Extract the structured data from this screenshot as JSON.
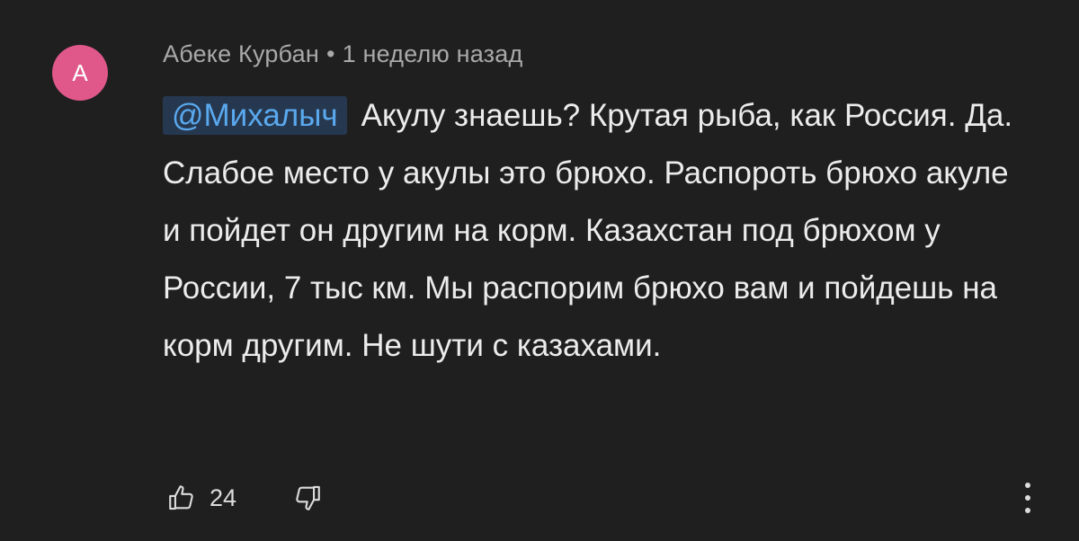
{
  "comment": {
    "avatar_letter": "A",
    "author": "Абеке Курбан",
    "separator": "•",
    "timestamp": "1 неделю назад",
    "mention": "@Михалыч",
    "text": "Акулу знаешь? Крутая рыба, как Россия. Да. Слабое место у акулы это брюхо. Распороть брюхо акуле и пойдет он другим на корм. Казахстан под брюхом у России, 7 тыс км. Мы распорим брюхо вам и пойдешь на корм другим. Не шути  с казахами.",
    "likes": "24"
  },
  "icons": {
    "like": "thumbs-up-icon",
    "dislike": "thumbs-down-icon",
    "more": "more-vertical-icon"
  },
  "colors": {
    "background": "#1f1f1f",
    "avatar": "#e0588a",
    "mention_text": "#5aa9ee",
    "mention_bg": "#263850",
    "meta_text": "#a9a9a9",
    "body_text": "#ececec"
  }
}
